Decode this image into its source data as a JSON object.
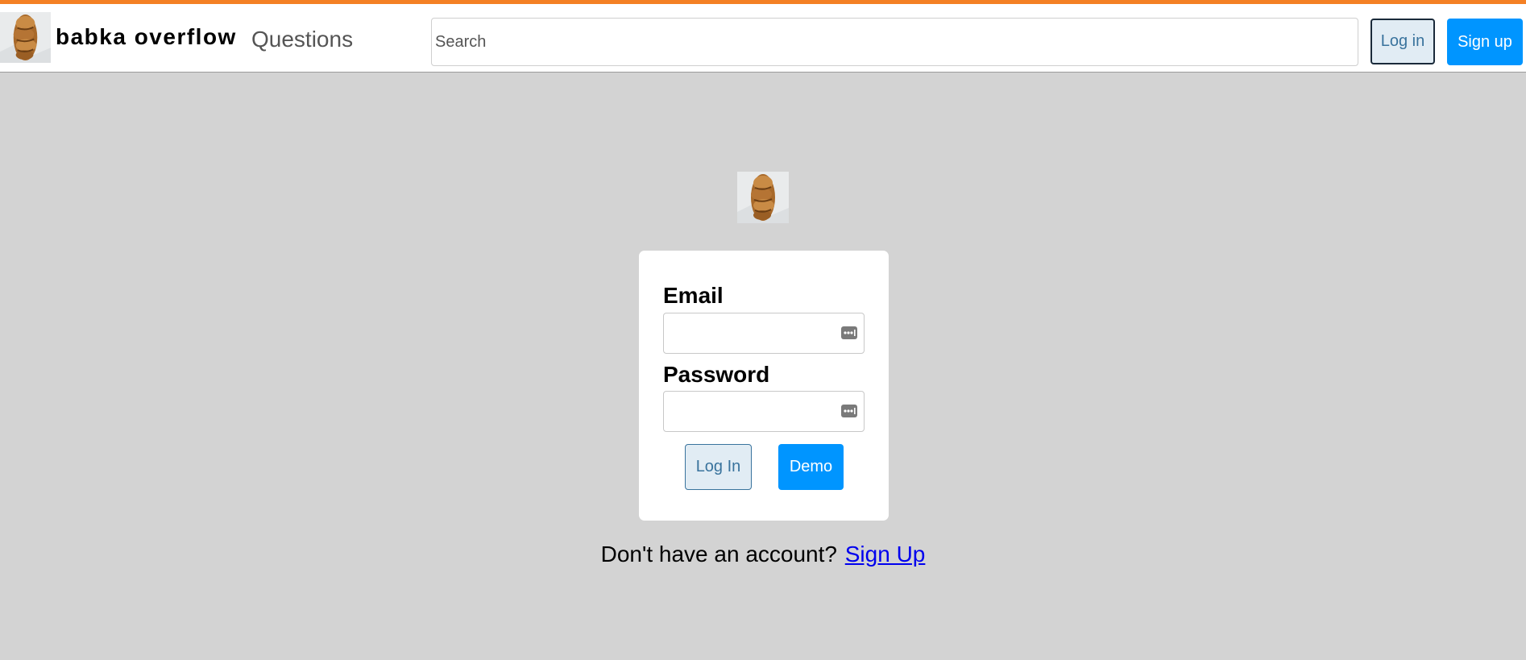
{
  "header": {
    "brand_name": "babka overflow",
    "nav_questions": "Questions",
    "search_placeholder": "Search",
    "login_label": "Log in",
    "signup_label": "Sign up"
  },
  "login_form": {
    "email_label": "Email",
    "email_value": "",
    "password_label": "Password",
    "password_value": "",
    "login_button": "Log In",
    "demo_button": "Demo"
  },
  "footer": {
    "prompt": "Don't have an account?",
    "signup_link": "Sign Up"
  },
  "icons": {
    "brand_logo": "babka-logo-icon",
    "center_logo": "babka-logo-icon",
    "password_manager": "password-manager-key-icon"
  },
  "colors": {
    "accent_top_border": "#f48024",
    "primary_button": "#0095ff",
    "secondary_button_bg": "#e1ecf4",
    "secondary_button_text": "#39739d",
    "page_background": "#d3d3d3",
    "link": "#0000ee"
  }
}
